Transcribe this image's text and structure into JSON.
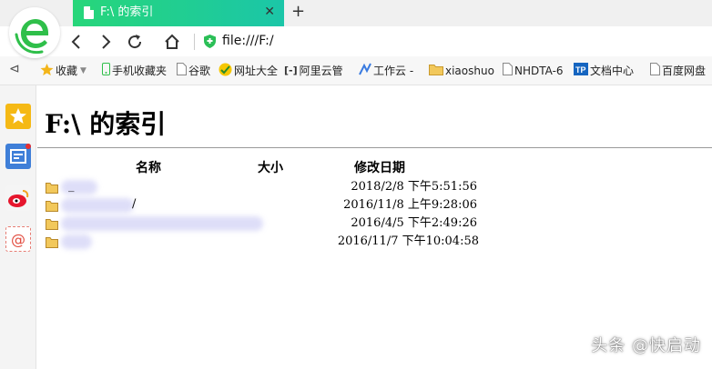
{
  "tab": {
    "title": "F:\\ 的索引"
  },
  "nav": {
    "address": "file:///F:/"
  },
  "bookmarks": [
    {
      "label": "收藏",
      "icon": "star-icon"
    },
    {
      "label": "手机收藏夹",
      "icon": "phone-icon"
    },
    {
      "label": "谷歌",
      "icon": "page-icon"
    },
    {
      "label": "网址大全",
      "icon": "globe-icon"
    },
    {
      "label": "阿里云管",
      "icon": "aliyun-icon"
    },
    {
      "label": "工作云 -",
      "icon": "workcloud-icon"
    },
    {
      "label": "xiaoshuo",
      "icon": "folder-icon"
    },
    {
      "label": "NHDTA-6",
      "icon": "page-icon"
    },
    {
      "label": "文档中心",
      "icon": "tp-icon"
    },
    {
      "label": "百度网盘",
      "icon": "page-icon"
    }
  ],
  "sidebar": [
    "favorites-star-icon",
    "news-icon",
    "weibo-icon",
    "mail-icon"
  ],
  "main": {
    "title": "F:\\  的索引",
    "columns": {
      "name": "名称",
      "size": "大小",
      "modified": "修改日期"
    },
    "rows": [
      {
        "name_visible": "_",
        "date": "2018/2/8 下午5:51:56"
      },
      {
        "name_visible": "/",
        "date": "2016/11/8 上午9:28:06"
      },
      {
        "name_visible": "",
        "date": "2016/4/5 下午2:49:26"
      },
      {
        "name_visible": "",
        "date": "2016/11/7 下午10:04:58"
      }
    ]
  },
  "watermark": "头条 @快启动",
  "colors": {
    "tab_start": "#27d67a",
    "tab_end": "#1bc6a8",
    "logo_green": "#2fbf4a"
  }
}
